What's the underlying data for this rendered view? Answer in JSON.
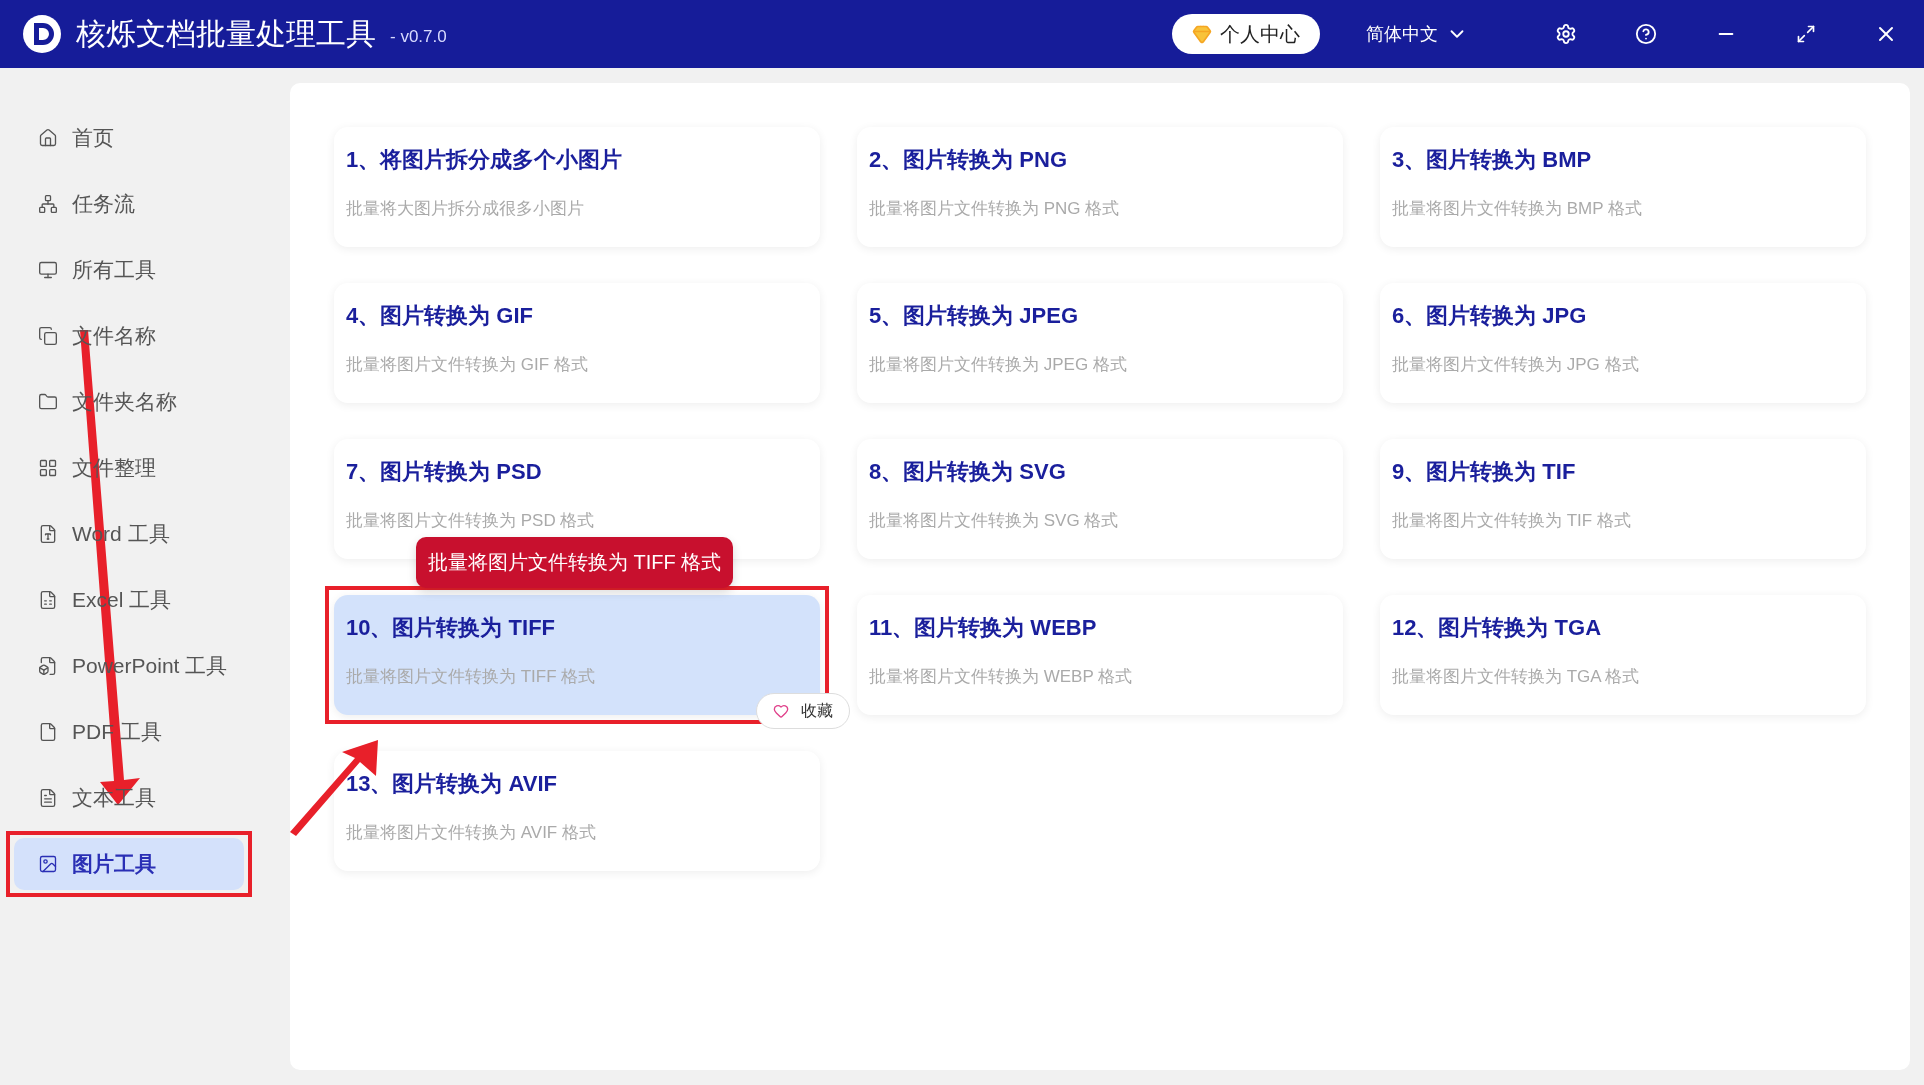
{
  "window": {
    "title": "核烁文档批量处理工具",
    "version": "- v0.7.0",
    "user_center": "个人中心",
    "language": "简体中文"
  },
  "sidebar": {
    "items": [
      {
        "label": "首页",
        "selected": false,
        "highlighted": false
      },
      {
        "label": "任务流",
        "selected": false,
        "highlighted": false
      },
      {
        "label": "所有工具",
        "selected": false,
        "highlighted": false
      },
      {
        "label": "文件名称",
        "selected": false,
        "highlighted": false
      },
      {
        "label": "文件夹名称",
        "selected": false,
        "highlighted": false
      },
      {
        "label": "文件整理",
        "selected": false,
        "highlighted": false
      },
      {
        "label": "Word 工具",
        "selected": false,
        "highlighted": false
      },
      {
        "label": "Excel 工具",
        "selected": false,
        "highlighted": false
      },
      {
        "label": "PowerPoint 工具",
        "selected": false,
        "highlighted": false
      },
      {
        "label": "PDF 工具",
        "selected": false,
        "highlighted": false
      },
      {
        "label": "文本工具",
        "selected": false,
        "highlighted": false
      },
      {
        "label": "图片工具",
        "selected": true,
        "highlighted": true
      }
    ]
  },
  "cards": [
    {
      "title": "1、将图片拆分成多个小图片",
      "description": "批量将大图片拆分成很多小图片",
      "selected": false,
      "highlighted": false
    },
    {
      "title": "2、图片转换为 PNG",
      "description": "批量将图片文件转换为 PNG 格式",
      "selected": false,
      "highlighted": false
    },
    {
      "title": "3、图片转换为 BMP",
      "description": "批量将图片文件转换为 BMP 格式",
      "selected": false,
      "highlighted": false
    },
    {
      "title": "4、图片转换为 GIF",
      "description": "批量将图片文件转换为 GIF 格式",
      "selected": false,
      "highlighted": false
    },
    {
      "title": "5、图片转换为 JPEG",
      "description": "批量将图片文件转换为 JPEG 格式",
      "selected": false,
      "highlighted": false
    },
    {
      "title": "6、图片转换为 JPG",
      "description": "批量将图片文件转换为 JPG 格式",
      "selected": false,
      "highlighted": false
    },
    {
      "title": "7、图片转换为 PSD",
      "description": "批量将图片文件转换为 PSD 格式",
      "selected": false,
      "highlighted": false
    },
    {
      "title": "8、图片转换为 SVG",
      "description": "批量将图片文件转换为 SVG 格式",
      "selected": false,
      "highlighted": false
    },
    {
      "title": "9、图片转换为 TIF",
      "description": "批量将图片文件转换为 TIF 格式",
      "selected": false,
      "highlighted": false
    },
    {
      "title": "10、图片转换为 TIFF",
      "description": "批量将图片文件转换为 TIFF 格式",
      "selected": true,
      "highlighted": true,
      "tooltip": "批量将图片文件转换为 TIFF 格式",
      "favorite_label": "收藏"
    },
    {
      "title": "11、图片转换为 WEBP",
      "description": "批量将图片文件转换为 WEBP 格式",
      "selected": false,
      "highlighted": false
    },
    {
      "title": "12、图片转换为 TGA",
      "description": "批量将图片文件转换为 TGA 格式",
      "selected": false,
      "highlighted": false
    },
    {
      "title": "13、图片转换为 AVIF",
      "description": "批量将图片文件转换为 AVIF 格式",
      "selected": false,
      "highlighted": false
    }
  ]
}
